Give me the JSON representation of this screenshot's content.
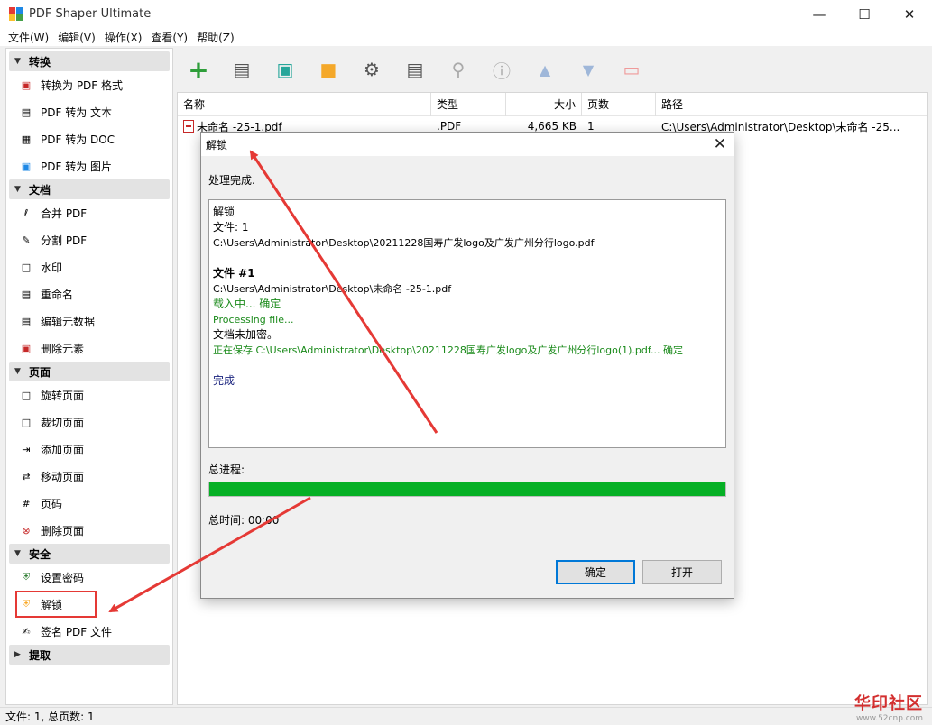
{
  "window": {
    "title": "PDF Shaper Ultimate"
  },
  "menu": [
    "文件(W)",
    "编辑(V)",
    "操作(X)",
    "查看(Y)",
    "帮助(Z)"
  ],
  "sidebar": {
    "convert": {
      "title": "转换",
      "items": [
        "转换为 PDF 格式",
        "PDF 转为 文本",
        "PDF 转为 DOC",
        "PDF 转为 图片"
      ]
    },
    "document": {
      "title": "文档",
      "items": [
        "合并 PDF",
        "分割 PDF",
        "水印",
        "重命名",
        "编辑元数据",
        "删除元素"
      ]
    },
    "pages": {
      "title": "页面",
      "items": [
        "旋转页面",
        "裁切页面",
        "添加页面",
        "移动页面",
        "页码",
        "删除页面"
      ]
    },
    "security": {
      "title": "安全",
      "items": [
        "设置密码",
        "解锁",
        "签名 PDF 文件"
      ]
    },
    "extract": {
      "title": "提取"
    }
  },
  "filelist": {
    "headers": {
      "name": "名称",
      "type": "类型",
      "size": "大小",
      "pages": "页数",
      "path": "路径"
    },
    "rows": [
      {
        "name": "未命名 -25-1.pdf",
        "type": ".PDF",
        "size": "4,665 KB",
        "pages": "1",
        "path": "C:\\Users\\Administrator\\Desktop\\未命名 -25..."
      }
    ]
  },
  "dialog": {
    "title": "解锁",
    "status": "处理完成.",
    "log": {
      "l1": "解锁",
      "l2": "文件: 1",
      "l3": "C:\\Users\\Administrator\\Desktop\\20211228国寿广发logo及广发广州分行logo.pdf",
      "l4": "文件 #1",
      "l5": "C:\\Users\\Administrator\\Desktop\\未命名 -25-1.pdf",
      "l6": "载入中... 确定",
      "l7": "Processing file...",
      "l8": "文档未加密。",
      "l9": "正在保存 C:\\Users\\Administrator\\Desktop\\20211228国寿广发logo及广发广州分行logo(1).pdf... 确定",
      "l10": "完成"
    },
    "progress_label": "总进程:",
    "progress": 1.0,
    "time": "总时间: 00:00",
    "ok": "确定",
    "open": "打开"
  },
  "statusbar": {
    "text": "文件: 1, 总页数: 1"
  },
  "watermark": {
    "text": "华印社区",
    "sub": "www.52cnp.com"
  },
  "colors": {
    "progress": "#06b025",
    "highlight": "#e53935",
    "accent": "#0078d7"
  }
}
